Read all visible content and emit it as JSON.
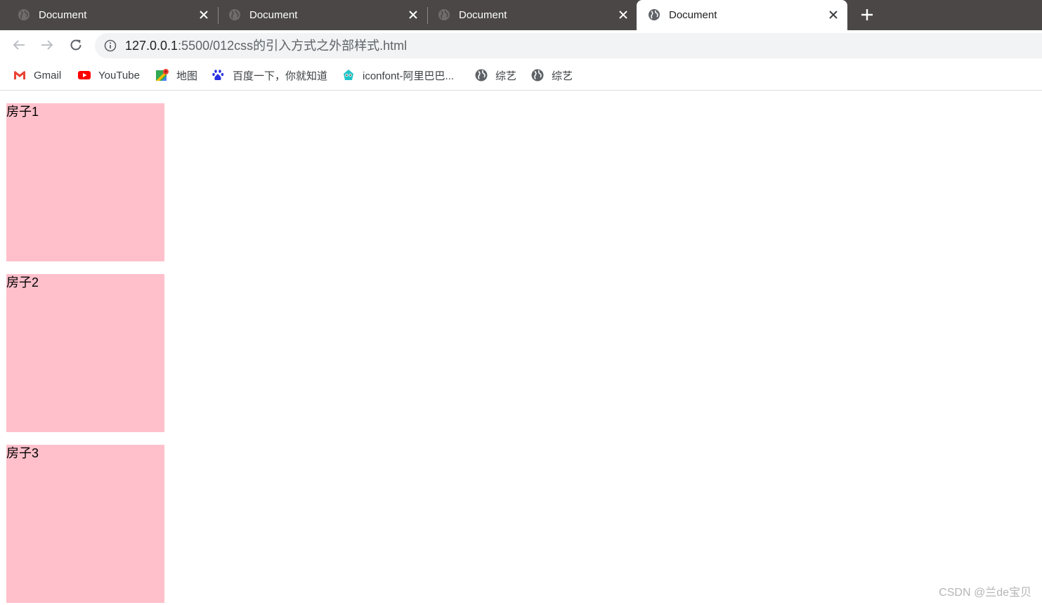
{
  "browser": {
    "tabs": [
      {
        "title": "Document",
        "active": false
      },
      {
        "title": "Document",
        "active": false
      },
      {
        "title": "Document",
        "active": false
      },
      {
        "title": "Document",
        "active": true
      }
    ],
    "address": {
      "host": "127.0.0.1",
      "path": ":5500/012css的引入方式之外部样式.html"
    },
    "bookmarks": [
      {
        "label": "Gmail",
        "icon": "gmail-icon"
      },
      {
        "label": "YouTube",
        "icon": "youtube-icon"
      },
      {
        "label": "地图",
        "icon": "maps-icon"
      },
      {
        "label": "百度一下，你就知道",
        "icon": "baidu-icon"
      },
      {
        "label": "iconfont-阿里巴巴...",
        "icon": "iconfont-icon"
      },
      {
        "label": "综艺",
        "icon": "globe-icon"
      },
      {
        "label": "综艺",
        "icon": "globe-icon"
      }
    ],
    "colors": {
      "tabstrip": "#4a4746",
      "omnibox": "#f1f3f4"
    }
  },
  "page": {
    "houses": [
      {
        "label": "房子1"
      },
      {
        "label": "房子2"
      },
      {
        "label": "房子3"
      }
    ],
    "box_color": "#ffc0cb",
    "watermark": "CSDN @兰de宝贝"
  }
}
